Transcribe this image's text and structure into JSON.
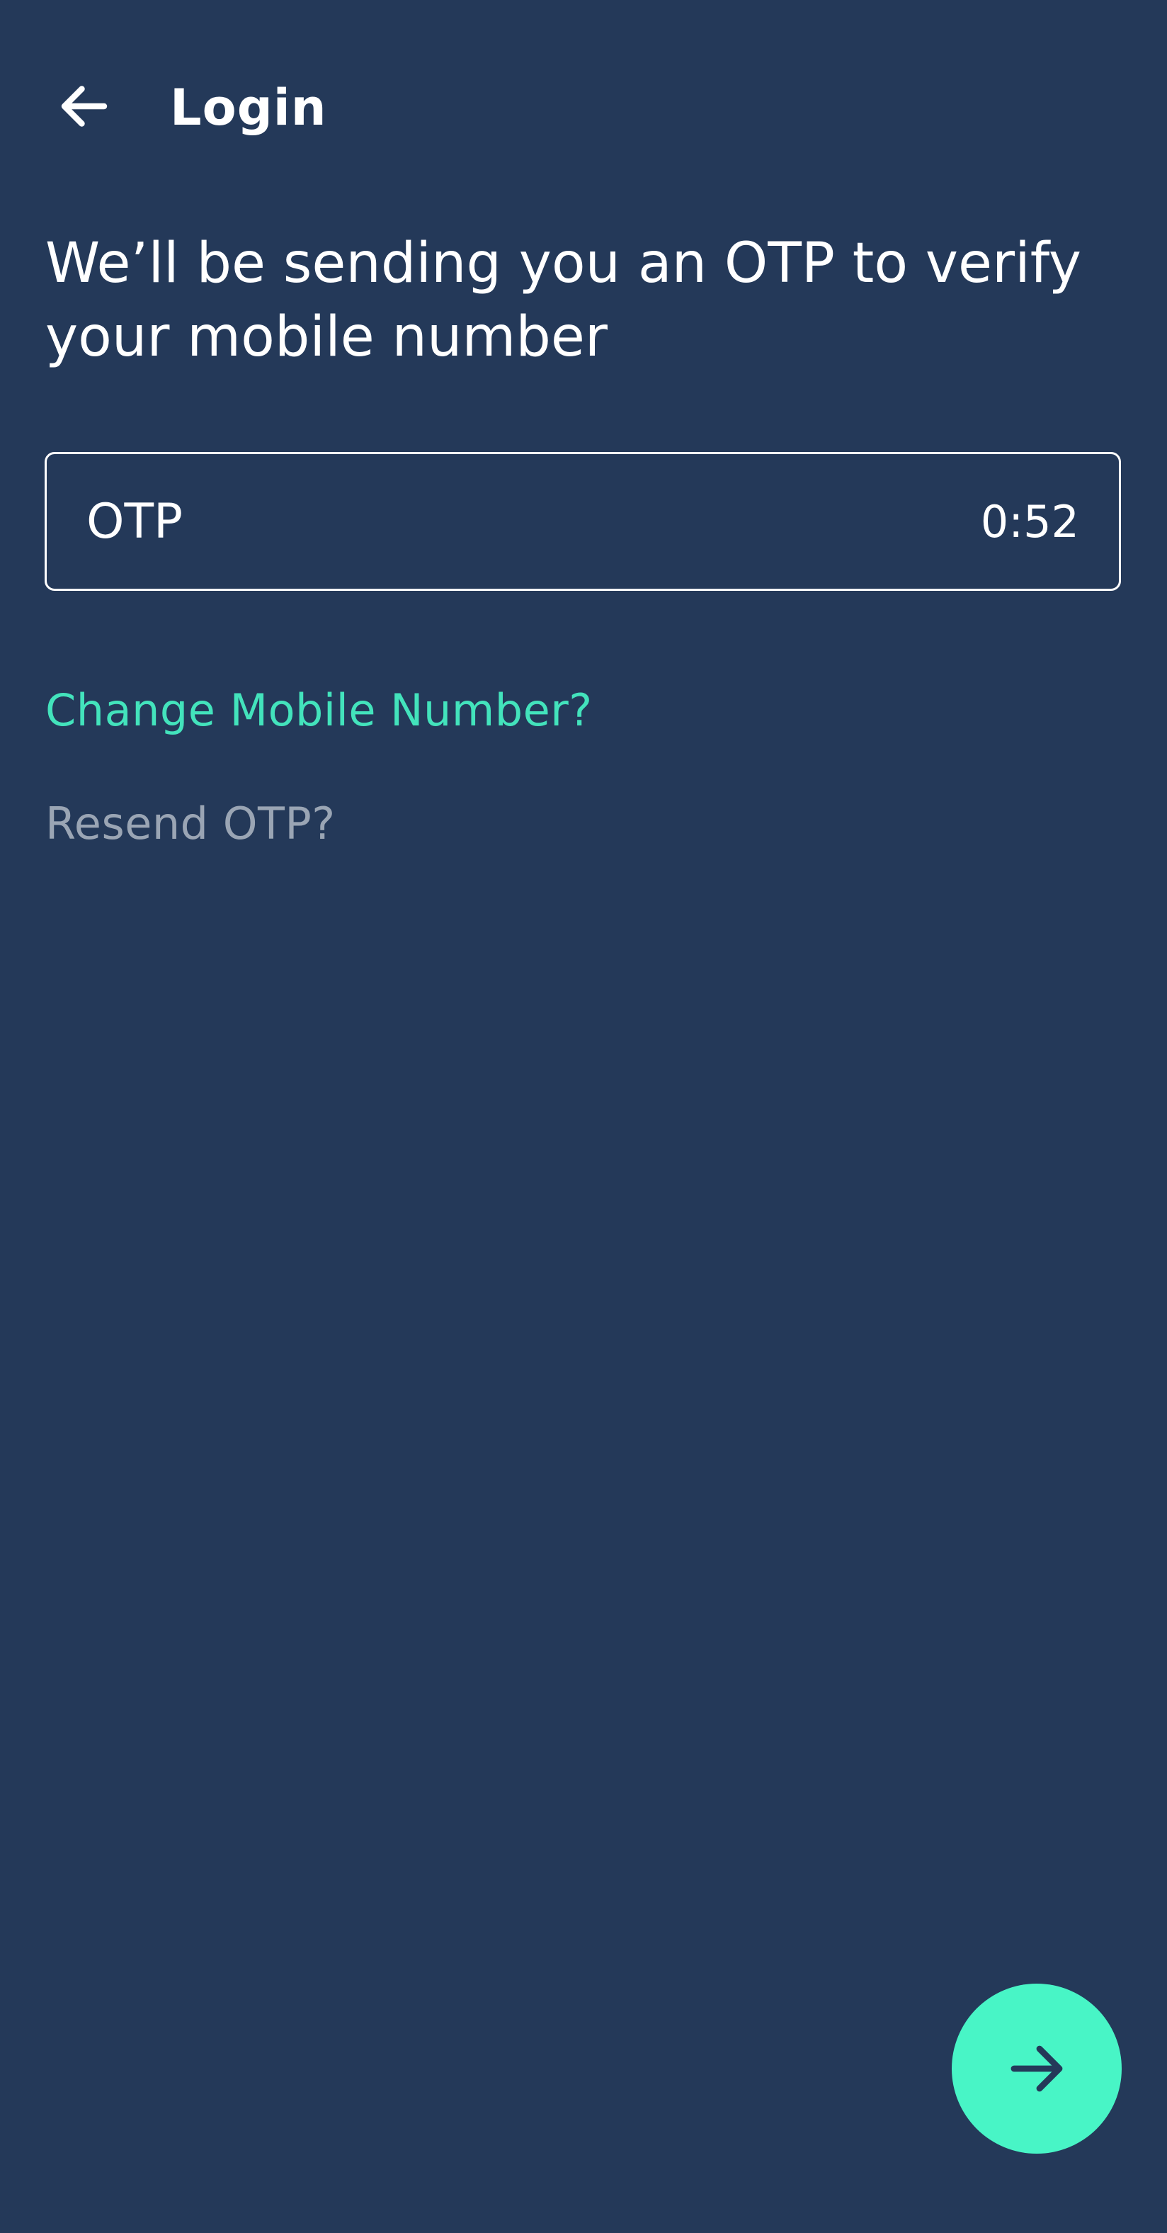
{
  "header": {
    "title": "Login",
    "back_icon": "arrow-left-icon"
  },
  "main": {
    "subtitle": "We’ll be sending you an OTP to verify your mobile number",
    "otp_field": {
      "placeholder": "OTP",
      "value": "",
      "timer": "0:52"
    },
    "change_number_label": "Change Mobile Number?",
    "resend_label": "Resend OTP?"
  },
  "fab": {
    "icon": "arrow-right-icon"
  },
  "colors": {
    "background": "#243959",
    "accent": "#48f5c6",
    "link": "#43e3bc",
    "disabled_text": "#9aa5b4"
  }
}
